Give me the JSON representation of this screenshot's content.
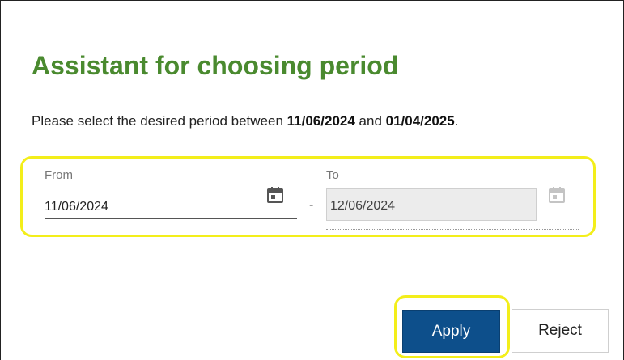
{
  "dialog": {
    "title": "Assistant for choosing period",
    "description": {
      "prefix": "Please select the desired period between ",
      "start": "11/06/2024",
      "middle": " and ",
      "end": "01/04/2025",
      "suffix": "."
    }
  },
  "range": {
    "from_label": "From",
    "from_value": "11/06/2024",
    "separator": "-",
    "to_label": "To",
    "to_value": "12/06/2024"
  },
  "buttons": {
    "apply_label": "Apply",
    "reject_label": "Reject"
  },
  "icons": {
    "from_calendar": "calendar-icon",
    "to_calendar": "calendar-icon"
  },
  "colors": {
    "title": "#4a8a2f",
    "apply": "#0d4f8b",
    "highlight": "#f3ee1a"
  }
}
